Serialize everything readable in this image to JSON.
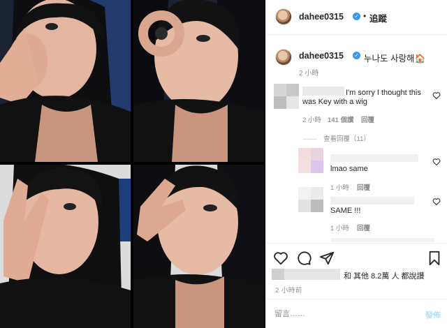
{
  "post": {
    "author": "dahee0315",
    "verified_icon": "✓",
    "separator": "•",
    "follow_label": "追蹤"
  },
  "caption": {
    "author": "dahee0315",
    "text": "누나도 사랑해🏠",
    "time": "2 小時"
  },
  "comments": [
    {
      "text": "I'm sorry I thought this was Key with a wig",
      "time": "2 小時",
      "likes": "141 個讚",
      "reply": "回覆"
    }
  ],
  "view_replies": "查看回覆（11）",
  "replies": [
    {
      "text": "lmao same",
      "time": "1 小時",
      "reply": "回覆"
    },
    {
      "text": "SAME !!!",
      "time": "1 小時",
      "reply": "回覆"
    }
  ],
  "likes": {
    "text": "和 其他 8.2萬 人 都說讚"
  },
  "time_ago": "2 小時前",
  "comment_box": {
    "placeholder": "留言……",
    "post_label": "發佈"
  },
  "colors": {
    "link": "#3897f0",
    "muted": "#8e8e8e",
    "post_disabled": "#b2dffc"
  },
  "icons": [
    "heart-icon",
    "comment-icon",
    "share-icon",
    "bookmark-icon",
    "verified-icon"
  ]
}
